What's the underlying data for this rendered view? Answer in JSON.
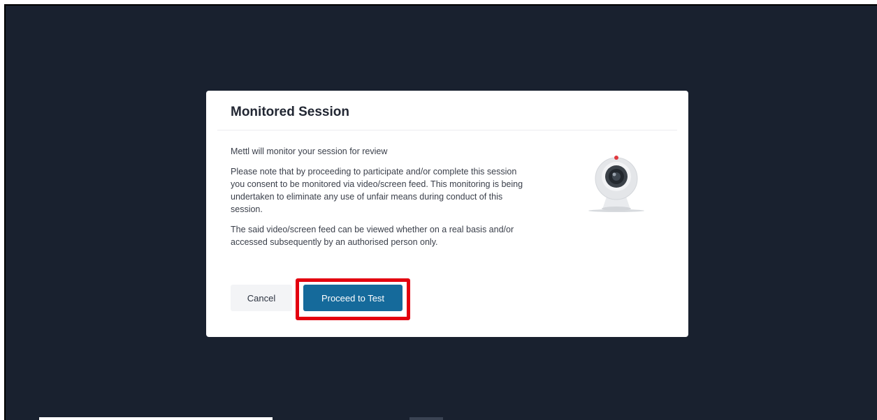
{
  "modal": {
    "title": "Monitored Session",
    "intro": "Mettl will monitor your session for review",
    "paragraph_consent": "Please note that by proceeding to participate and/or complete this session you consent to be monitored via video/screen feed. This monitoring is being undertaken to eliminate any use of unfair means during conduct of this session.",
    "paragraph_viewing": "The said video/screen feed can be viewed whether on a real basis and/or accessed subsequently by an authorised person only.",
    "illustration_icon": "webcam-icon",
    "buttons": {
      "cancel_label": "Cancel",
      "proceed_label": "Proceed to Test"
    }
  },
  "colors": {
    "backdrop": "#19212f",
    "primary_button": "#156a9b",
    "highlight_outline": "#e3000f",
    "webcam_indicator": "#e0393f"
  }
}
